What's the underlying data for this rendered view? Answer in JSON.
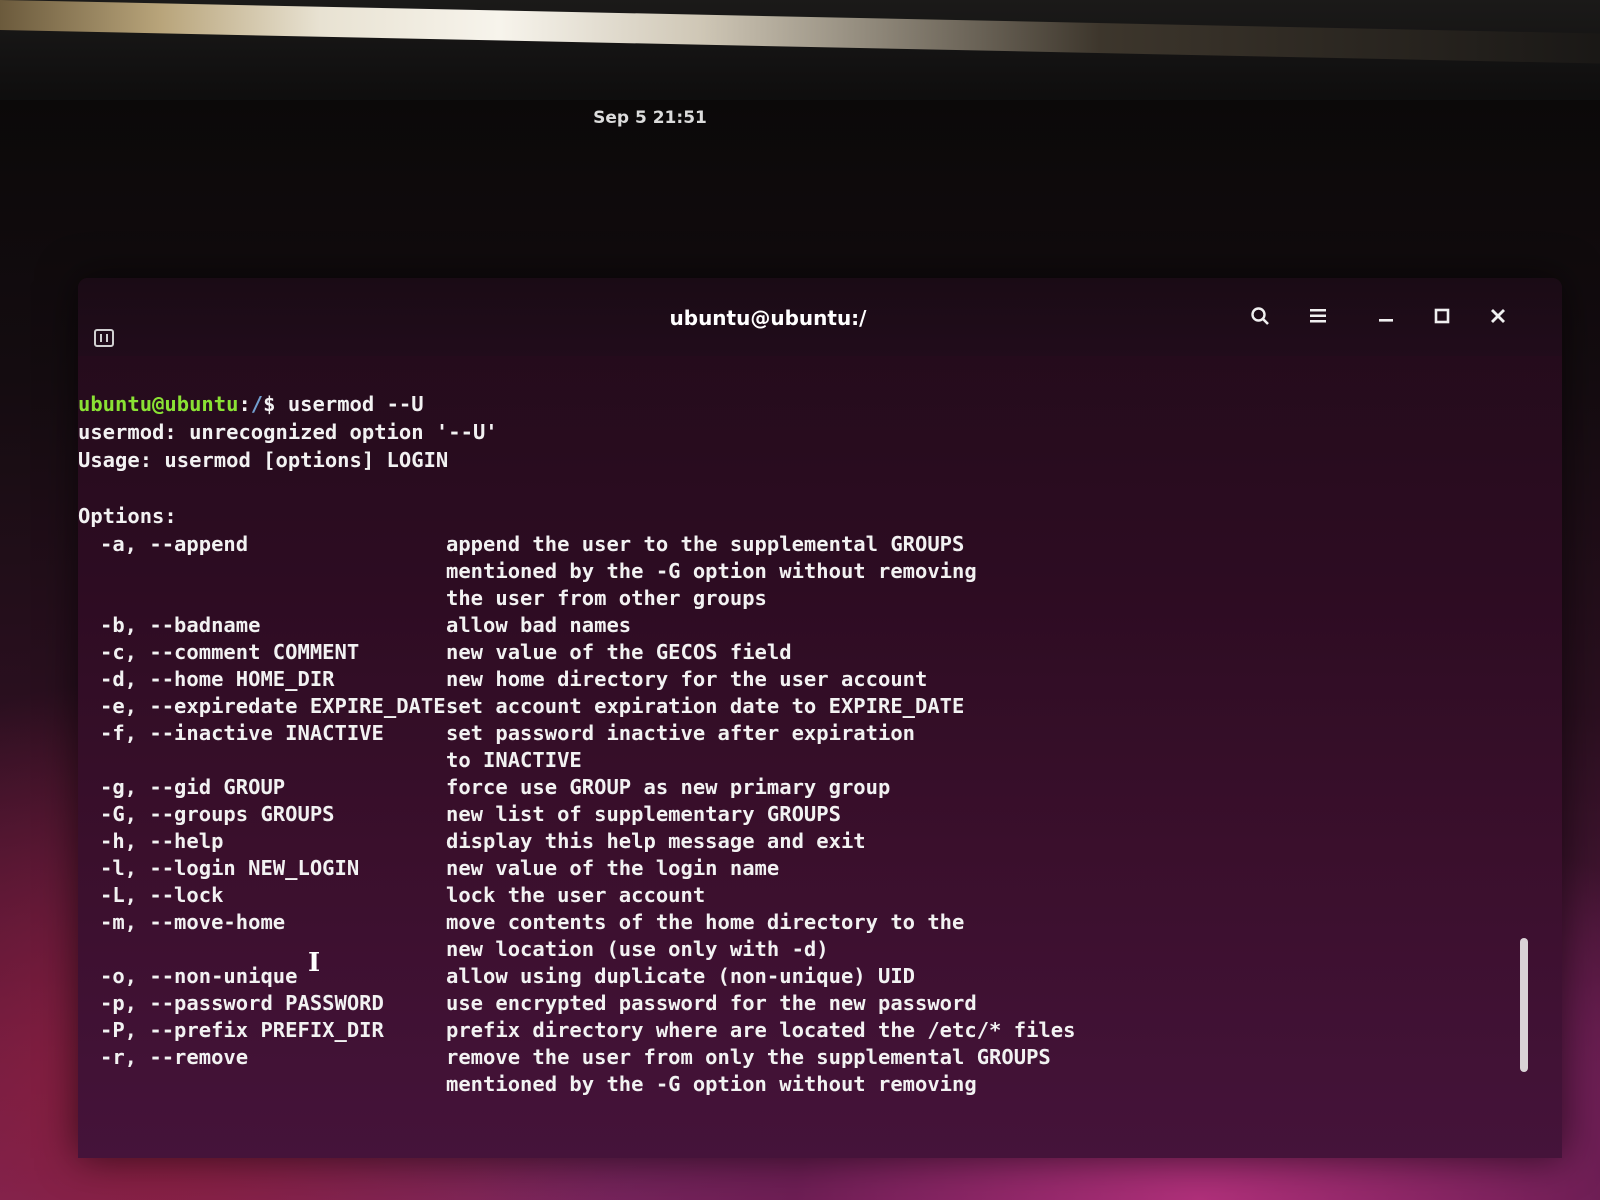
{
  "topbar": {
    "clock": "Sep 5 21:51"
  },
  "window": {
    "title": "ubuntu@ubuntu:/",
    "icons": {
      "new_tab": "new-tab-icon",
      "search": "search-icon",
      "menu": "hamburger-menu-icon",
      "minimize": "minimize-icon",
      "maximize": "maximize-icon",
      "close": "close-icon"
    }
  },
  "terminal": {
    "prompt": {
      "user_host": "ubuntu@ubuntu",
      "sep": ":",
      "path": "/",
      "symbol": "$ ",
      "command": "usermod --U"
    },
    "error_line": "usermod: unrecognized option '--U'",
    "usage_line": "Usage: usermod [options] LOGIN",
    "options_header": "Options:",
    "options": [
      {
        "flag": "-a, --append",
        "desc": "append the user to the supplemental GROUPS"
      },
      {
        "flag": "",
        "desc": "mentioned by the -G option without removing"
      },
      {
        "flag": "",
        "desc": "the user from other groups"
      },
      {
        "flag": "-b, --badname",
        "desc": "allow bad names"
      },
      {
        "flag": "-c, --comment COMMENT",
        "desc": "new value of the GECOS field"
      },
      {
        "flag": "-d, --home HOME_DIR",
        "desc": "new home directory for the user account"
      },
      {
        "flag": "-e, --expiredate EXPIRE_DATE",
        "desc": "set account expiration date to EXPIRE_DATE"
      },
      {
        "flag": "-f, --inactive INACTIVE",
        "desc": "set password inactive after expiration"
      },
      {
        "flag": "",
        "desc": "to INACTIVE"
      },
      {
        "flag": "-g, --gid GROUP",
        "desc": "force use GROUP as new primary group"
      },
      {
        "flag": "-G, --groups GROUPS",
        "desc": "new list of supplementary GROUPS"
      },
      {
        "flag": "-h, --help",
        "desc": "display this help message and exit"
      },
      {
        "flag": "-l, --login NEW_LOGIN",
        "desc": "new value of the login name"
      },
      {
        "flag": "-L, --lock",
        "desc": "lock the user account"
      },
      {
        "flag": "-m, --move-home",
        "desc": "move contents of the home directory to the"
      },
      {
        "flag": "",
        "desc": "new location (use only with -d)"
      },
      {
        "flag": "-o, --non-unique",
        "desc": "allow using duplicate (non-unique) UID"
      },
      {
        "flag": "-p, --password PASSWORD",
        "desc": "use encrypted password for the new password"
      },
      {
        "flag": "-P, --prefix PREFIX_DIR",
        "desc": "prefix directory where are located the /etc/* files"
      },
      {
        "flag": "-r, --remove",
        "desc": "remove the user from only the supplemental GROUPS"
      },
      {
        "flag": "",
        "desc": "mentioned by the -G option without removing"
      }
    ]
  },
  "colors": {
    "prompt_user": "#8ae234",
    "prompt_path": "#729fcf",
    "text": "#f2f2f2",
    "terminal_bg": "#300a24"
  }
}
